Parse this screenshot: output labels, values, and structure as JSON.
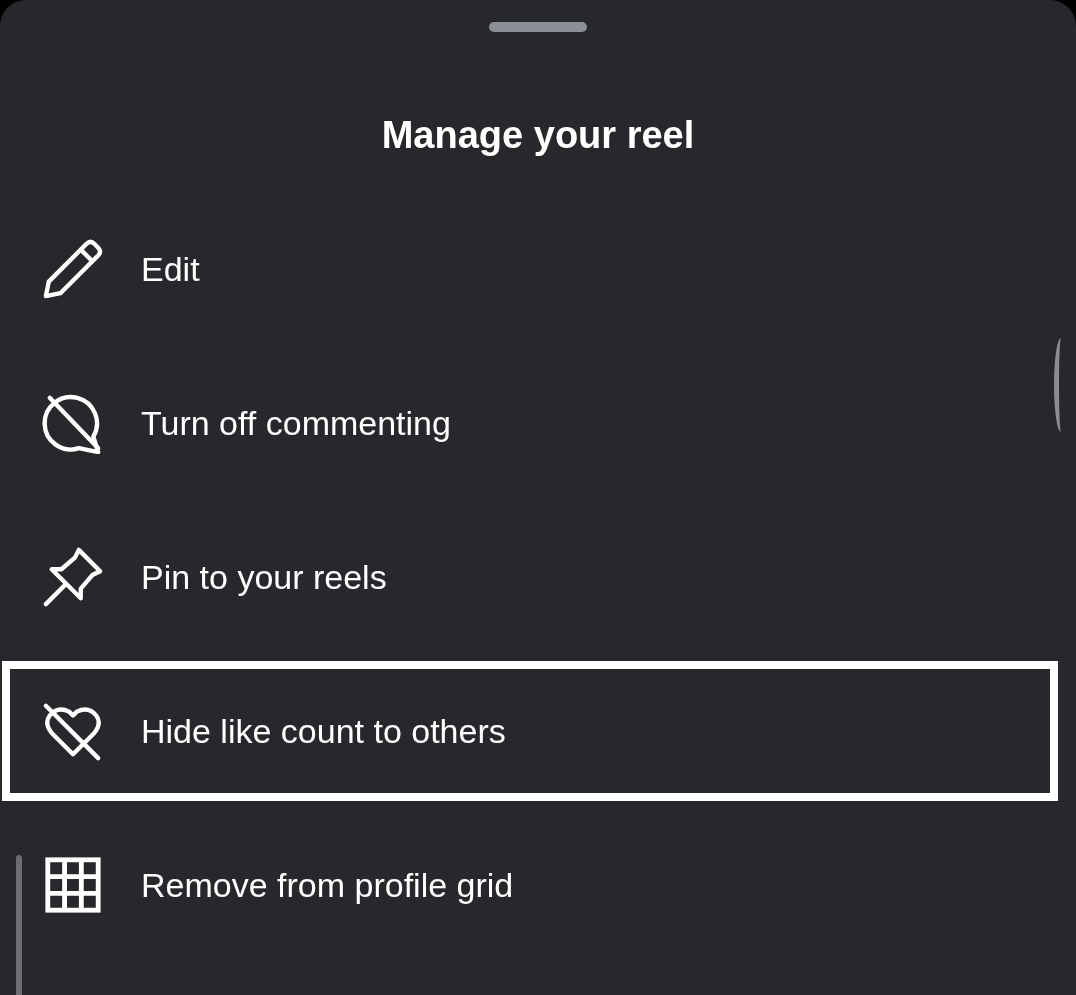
{
  "sheet": {
    "title": "Manage your reel"
  },
  "items": [
    {
      "kind": "edit",
      "label": "Edit",
      "highlighted": false
    },
    {
      "kind": "comments-off",
      "label": "Turn off commenting",
      "highlighted": false
    },
    {
      "kind": "pin",
      "label": "Pin to your reels",
      "highlighted": false
    },
    {
      "kind": "hide-likes",
      "label": "Hide like count to others",
      "highlighted": true
    },
    {
      "kind": "grid",
      "label": "Remove from profile grid",
      "highlighted": false
    }
  ]
}
